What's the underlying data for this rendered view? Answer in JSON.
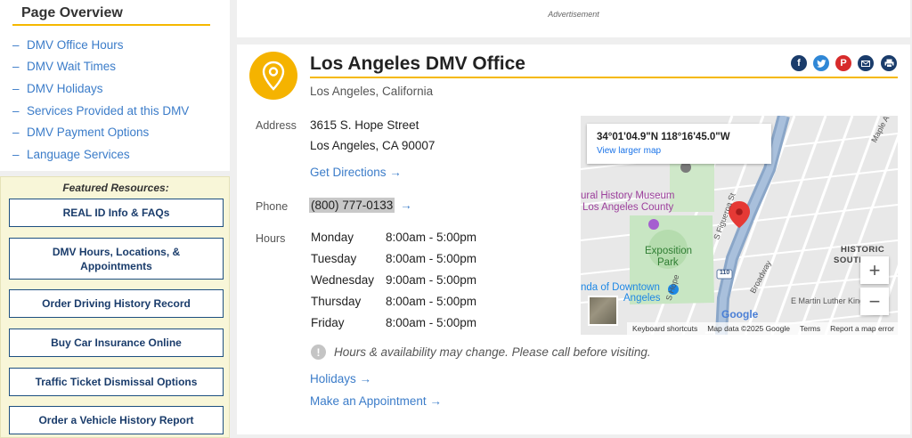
{
  "overview": {
    "title": "Page Overview",
    "items": [
      "DMV Office Hours",
      "DMV Wait Times",
      "DMV Holidays",
      "Services Provided at this DMV",
      "DMV Payment Options",
      "Language Services"
    ]
  },
  "featured": {
    "title": "Featured Resources:",
    "buttons": [
      "REAL ID Info & FAQs",
      "DMV Hours, Locations, & Appointments",
      "Order Driving History Record",
      "Buy Car Insurance Online",
      "Traffic Ticket Dismissal Options",
      "Order a Vehicle History Report"
    ]
  },
  "ad_label": "Advertisement",
  "office": {
    "title": "Los Angeles DMV Office",
    "subtitle": "Los Angeles, California",
    "address_label": "Address",
    "address_line1": "3615 S. Hope Street",
    "address_line2": "Los Angeles, CA 90007",
    "directions": "Get Directions →",
    "phone_label": "Phone",
    "phone": "(800) 777-0133",
    "phone_arrow": "→",
    "hours_label": "Hours",
    "hours": [
      {
        "day": "Monday",
        "time": "8:00am - 5:00pm"
      },
      {
        "day": "Tuesday",
        "time": "8:00am - 5:00pm"
      },
      {
        "day": "Wednesday",
        "time": "9:00am - 5:00pm"
      },
      {
        "day": "Thursday",
        "time": "8:00am - 5:00pm"
      },
      {
        "day": "Friday",
        "time": "8:00am - 5:00pm"
      }
    ],
    "notice": "Hours & availability may change. Please call before visiting.",
    "holidays_link": "Holidays →",
    "appointment_link": "Make an Appointment →"
  },
  "share_icons": [
    "facebook-icon",
    "twitter-icon",
    "pinterest-icon",
    "email-icon",
    "print-icon"
  ],
  "map": {
    "coordinates": "34°01'04.9\"N 118°16'45.0\"W",
    "larger_map": "View larger map",
    "labels": {
      "museum1": "ural History Museum",
      "museum2": "Los Angeles County",
      "exposition": "Exposition",
      "park": "Park",
      "rosegarden1": "nda of Downtown",
      "rosegarden2": "Angeles",
      "historic": "HISTORIC",
      "south": "SOUTH-C",
      "mlk": "E Martin Luther King",
      "broadway": "Broadway",
      "figueroa": "S Figueroa St",
      "hope": "S Hope",
      "maple": "Maple A",
      "highway": "110"
    },
    "zoom_in": "+",
    "zoom_out": "−",
    "google": "Google",
    "footer": {
      "shortcuts": "Keyboard shortcuts",
      "mapdata": "Map data ©2025 Google",
      "terms": "Terms",
      "report": "Report a map error"
    }
  },
  "colors": {
    "accent_yellow": "#f5b800",
    "link_blue": "#3b7cc9",
    "navy": "#1a3c6b",
    "featured_bg": "#f8f6d8"
  }
}
